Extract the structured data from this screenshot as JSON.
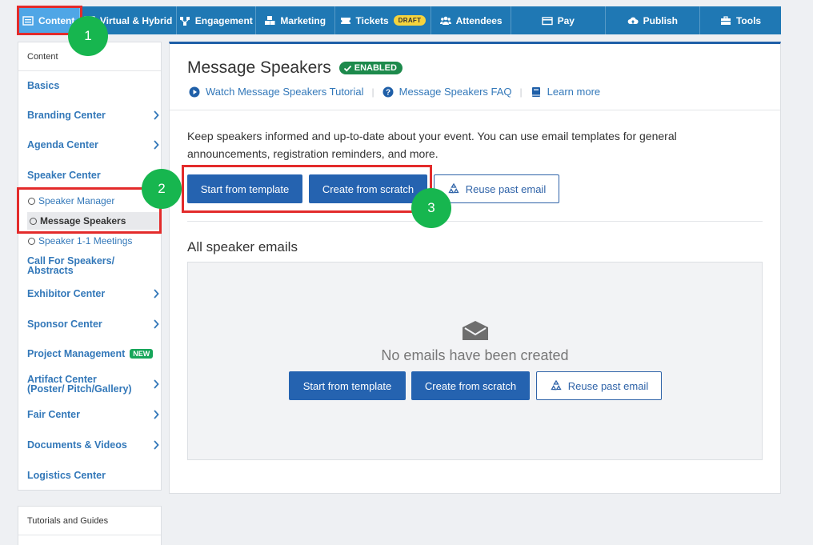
{
  "topnav": {
    "items": [
      {
        "label": "Content",
        "icon": "content-icon"
      },
      {
        "label": "Virtual & Hybrid",
        "icon": "screen-icon"
      },
      {
        "label": "Engagement",
        "icon": "network-icon"
      },
      {
        "label": "Marketing",
        "icon": "cubes-icon"
      },
      {
        "label": "Tickets",
        "icon": "ticket-icon",
        "badge": "DRAFT"
      },
      {
        "label": "Attendees",
        "icon": "users-icon"
      },
      {
        "label": "Pay",
        "icon": "card-icon"
      },
      {
        "label": "Publish",
        "icon": "cloud-upload-icon"
      },
      {
        "label": "Tools",
        "icon": "toolbox-icon"
      }
    ]
  },
  "annotations": [
    "1",
    "2",
    "3"
  ],
  "sidebar": {
    "header": "Content",
    "items": [
      {
        "label": "Basics"
      },
      {
        "label": "Branding Center"
      },
      {
        "label": "Agenda Center"
      },
      {
        "label": "Speaker Center"
      },
      {
        "label": "Call For Speakers/ Abstracts"
      },
      {
        "label": "Exhibitor Center"
      },
      {
        "label": "Sponsor Center"
      },
      {
        "label": "Project Management",
        "badge": "NEW"
      },
      {
        "label": "Artifact Center (Poster/ Pitch/Gallery)"
      },
      {
        "label": "Fair Center"
      },
      {
        "label": "Documents & Videos"
      },
      {
        "label": "Logistics Center"
      }
    ],
    "subitems": [
      {
        "label": "Speaker Manager"
      },
      {
        "label": "Message Speakers"
      },
      {
        "label": "Speaker 1-1 Meetings"
      }
    ]
  },
  "sidebar2": {
    "header": "Tutorials and Guides"
  },
  "main": {
    "title": "Message Speakers",
    "status": "ENABLED",
    "links": {
      "tutorial": "Watch Message Speakers Tutorial",
      "faq": "Message Speakers FAQ",
      "learn": "Learn more"
    },
    "description": "Keep speakers informed and up-to-date about your event. You can use email templates for general announcements, registration reminders, and more.",
    "buttons": {
      "template": "Start from template",
      "scratch": "Create from scratch",
      "reuse": "Reuse past email"
    },
    "section_title": "All speaker emails",
    "empty_text": "No emails have been created"
  },
  "colors": {
    "nav": "#1f78b4",
    "nav_active": "#4fa6e6",
    "primary": "#2563b0",
    "link": "#3378b9",
    "enabled": "#1d8a4c",
    "annotation_box": "#e32b2b",
    "annotation_circle": "#17b64f"
  }
}
